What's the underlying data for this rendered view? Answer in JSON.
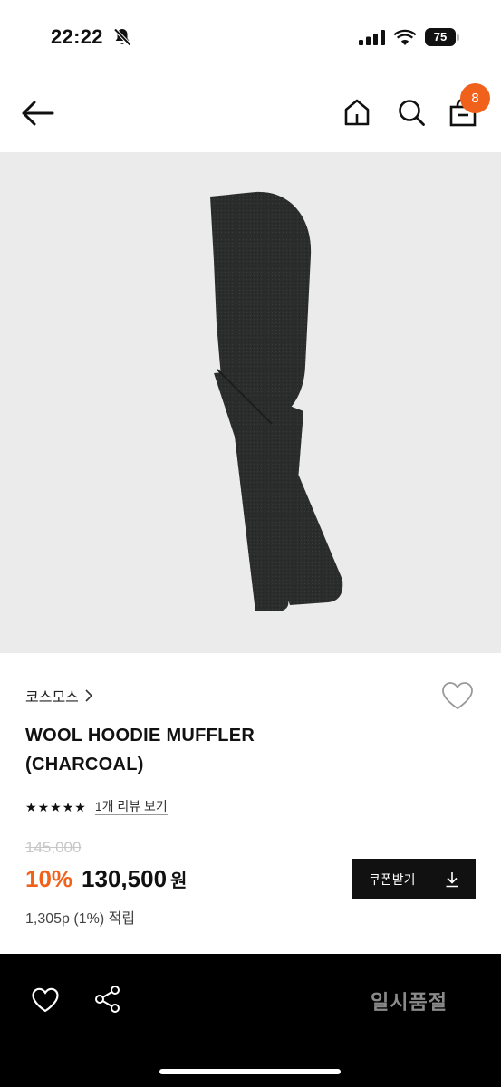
{
  "status_bar": {
    "time": "22:22",
    "battery_level": "75",
    "icons": [
      "mute-bell-icon",
      "signal-icon",
      "wifi-icon",
      "battery-icon"
    ]
  },
  "header": {
    "icons": [
      "back-arrow-icon",
      "home-icon",
      "search-icon",
      "shopping-bag-icon"
    ],
    "cart_count": "8"
  },
  "product": {
    "image_subject": "charcoal wool hoodie muffler",
    "brand": "코스모스",
    "title_line1": "WOOL HOODIE MUFFLER",
    "title_line2": "(CHARCOAL)",
    "rating_stars": 5,
    "review_link": "1개 리뷰 보기",
    "original_price": "145,000",
    "discount": "10%",
    "sale_price": "130,500",
    "currency": "원",
    "points": "1,305p (1%) 적립"
  },
  "coupon": {
    "label": "쿠폰받기",
    "icon": "download-icon"
  },
  "bottom_bar": {
    "soldout_label": "일시품절",
    "icons": [
      "heart-icon",
      "share-icon"
    ]
  },
  "colors": {
    "accent": "#f0611c",
    "image_bg": "#ebebeb",
    "product": "#2b2c2c",
    "bottom_bar": "#000000",
    "soldout_text": "#8a8a8a"
  }
}
